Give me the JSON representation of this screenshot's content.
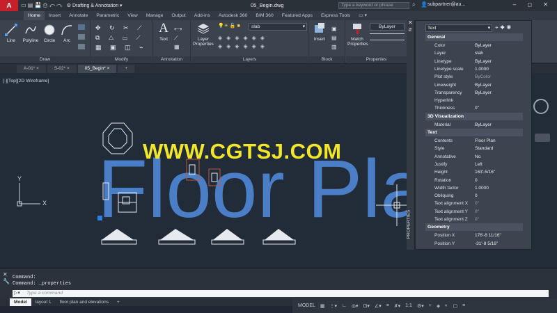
{
  "titlebar": {
    "logo": "A",
    "workspace": "Drafting & Annotation",
    "document": "05_Begin.dwg",
    "search_placeholder": "Type a keyword or phrase",
    "user": "subpartner@au..."
  },
  "ribbon_tabs": [
    "Home",
    "Insert",
    "Annotate",
    "Parametric",
    "View",
    "Manage",
    "Output",
    "Add-ins",
    "Autodesk 360",
    "BIM 360",
    "Featured Apps",
    "Express Tools"
  ],
  "ribbon": {
    "draw": {
      "label": "Draw",
      "tools": [
        "Line",
        "Polyline",
        "Circle",
        "Arc"
      ]
    },
    "modify": {
      "label": "Modify"
    },
    "annotation": {
      "label": "Annotation",
      "tools": [
        "Text"
      ]
    },
    "layers": {
      "label": "Layers",
      "layer_properties": "Layer Properties",
      "current_layer": "slab"
    },
    "block": {
      "label": "Block",
      "tools": [
        "Insert"
      ]
    },
    "properties": {
      "label": "Properties",
      "match": "Match Properties",
      "bylayer": "ByLayer"
    }
  },
  "file_tabs": [
    "A-01*",
    "S-02*",
    "05_Begin*"
  ],
  "viewport_label": "[-][Top][2D Wireframe]",
  "drawing": {
    "text": "Floor Plan",
    "watermark": "WWW.CGTSJ.COM",
    "ucs_y": "Y",
    "ucs_x": "X"
  },
  "command": {
    "line1": "Command:",
    "line2": "Command:  _properties",
    "placeholder": "Type a command"
  },
  "layout_tabs": [
    "Model",
    "layout 1",
    "floor plan and elevations"
  ],
  "status": {
    "model": "MODEL",
    "scale": "1:1"
  },
  "properties_palette": {
    "side_label": "PROPERTIES",
    "selected": "Text",
    "sections": [
      {
        "title": "General",
        "rows": [
          [
            "Color",
            "ByLayer"
          ],
          [
            "Layer",
            "slab"
          ],
          [
            "Linetype",
            "ByLayer"
          ],
          [
            "Linetype scale",
            "1.0000"
          ],
          [
            "Plot style",
            "ByColor"
          ],
          [
            "Lineweight",
            "ByLayer"
          ],
          [
            "Transparency",
            "ByLayer"
          ],
          [
            "Hyperlink",
            ""
          ],
          [
            "Thickness",
            "0\""
          ]
        ]
      },
      {
        "title": "3D Visualization",
        "rows": [
          [
            "Material",
            "ByLayer"
          ]
        ]
      },
      {
        "title": "Text",
        "rows": [
          [
            "Contents",
            "Floor Plan"
          ],
          [
            "Style",
            "Standard"
          ],
          [
            "Annotative",
            "No"
          ],
          [
            "Justify",
            "Left"
          ],
          [
            "Height",
            "163'-5/16\""
          ],
          [
            "Rotation",
            "0"
          ],
          [
            "Width factor",
            "1.0000"
          ],
          [
            "Obliquing",
            "0"
          ],
          [
            "Text alignment X",
            "0\""
          ],
          [
            "Text alignment Y",
            "0\""
          ],
          [
            "Text alignment Z",
            "0\""
          ]
        ]
      },
      {
        "title": "Geometry",
        "rows": [
          [
            "Position X",
            "176'-8 11/16\""
          ],
          [
            "Position Y",
            "-31'-8 5/16\""
          ]
        ]
      }
    ]
  },
  "colors": {
    "accent_red": "#c8202a",
    "floorplan_text": "#4a7fc8",
    "watermark": "#f2e62a",
    "canvas": "#222b38"
  }
}
